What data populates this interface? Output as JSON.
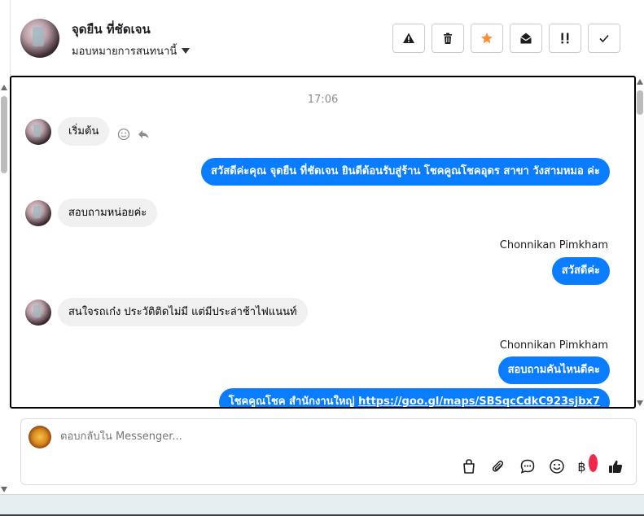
{
  "header": {
    "contact_name": "จุดยืน ที่ชัดเจน",
    "assign_label": "มอบหมายการสนทนานี้",
    "actions": [
      {
        "name": "report-button",
        "icon": "warning-icon"
      },
      {
        "name": "delete-button",
        "icon": "trash-icon"
      },
      {
        "name": "star-button",
        "icon": "star-icon"
      },
      {
        "name": "mark-unread-button",
        "icon": "envelope-open-icon"
      },
      {
        "name": "follow-up-button",
        "icon": "exclamation-icon"
      },
      {
        "name": "done-button",
        "icon": "check-icon"
      }
    ]
  },
  "conversation": {
    "timestamp": "17:06",
    "messages": [
      {
        "direction": "in",
        "text": "เริ่มต้น"
      },
      {
        "direction": "out",
        "text": "สวัสดีค่ะคุณ จุดยืน ที่ชัดเจน ยินดีต้อนรับสู่ร้าน โชคคูณโชคอุดร สาขา วังสามหมอ ค่ะ"
      },
      {
        "direction": "in",
        "text": "สอบถามหน่อยค่ะ"
      },
      {
        "direction": "out",
        "sender": "Chonnikan Pimkham",
        "text": "สวัสดีค่ะ"
      },
      {
        "direction": "in",
        "text": "สนใจรถเก๋ง  ประวัติติดไม่มี  แต่มีประล่าช้าไฟแนนท์"
      },
      {
        "direction": "out",
        "sender": "Chonnikan Pimkham",
        "text": "สอบถามคันไหนดีคะ"
      },
      {
        "direction": "out",
        "text": "โชคคูณโชค สำนักงานใหญ่ ",
        "link": "https://goo.gl/maps/SBSqcCdkC923sjbx7"
      }
    ]
  },
  "composer": {
    "placeholder": "ตอบกลับใน Messenger...",
    "tools": [
      "bag-icon",
      "paperclip-icon",
      "chat-bubble-icon",
      "emoji-icon",
      "baht-icon",
      "thumbs-up-icon"
    ],
    "baht_symbol": "฿"
  },
  "colors": {
    "accent": "#0a7cff",
    "star": "#f7923b",
    "notification": "#f02849"
  }
}
